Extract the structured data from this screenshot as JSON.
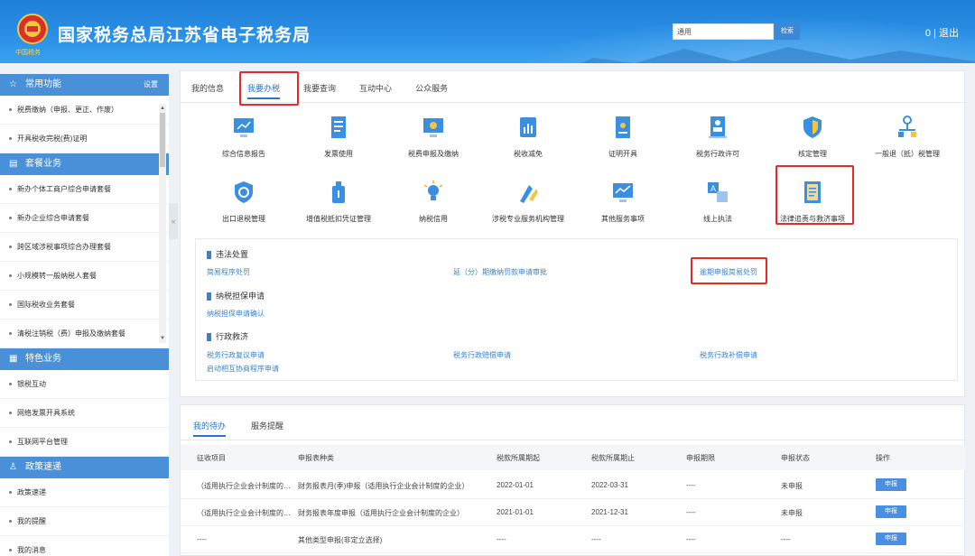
{
  "header": {
    "title": "国家税务总局江苏省电子税务局",
    "logo_sub": "中国税务",
    "search_value": "通用",
    "search_btn": "检索",
    "links": "0 | 退出"
  },
  "sidebar": {
    "section1": {
      "title": "常用功能",
      "extra": "设置"
    },
    "section1_items": [
      "税费缴纳（申报、更正、作废）",
      "开具税收完税(费)证明"
    ],
    "section2": {
      "title": "套餐业务"
    },
    "section2_items": [
      "新办个体工商户综合申请套餐",
      "新办企业综合申请套餐",
      "跨区域涉税事项综合办理套餐",
      "小规模转一般纳税人套餐",
      "国际税收业务套餐",
      "清税注销税（费）申报及缴纳套餐"
    ],
    "section3": {
      "title": "特色业务"
    },
    "section3_items": [
      "银税互动",
      "网络发票开具系统",
      "互联网平台管理"
    ],
    "section4": {
      "title": "政策速递"
    },
    "section4_items": [
      "政策速递",
      "我的提醒",
      "我的消息"
    ]
  },
  "tabs": [
    "我的信息",
    "我要办税",
    "我要查询",
    "互动中心",
    "公众服务"
  ],
  "icons_row1": [
    "综合信息报告",
    "发票使用",
    "税费申报及缴纳",
    "税收减免",
    "证明开具",
    "税务行政许可",
    "核定管理",
    "一般退（抵）税管理"
  ],
  "icons_row2": [
    "出口退税管理",
    "增值税抵扣凭证管理",
    "纳税信用",
    "涉税专业服务机构管理",
    "其他服务事项",
    "线上执法",
    "法律追责与救济事项"
  ],
  "sub": {
    "group1": "违法处置",
    "group1_links": [
      "简易程序处罚",
      "延（分）期缴纳罚款申请审批",
      "逾期申报简易处罚"
    ],
    "group2": "纳税担保申请",
    "group2_links": [
      "纳税担保申请确认"
    ],
    "group3": "行政救济",
    "group3_links": [
      "税务行政复议申请",
      "税务行政赔偿申请",
      "税务行政补偿申请",
      "启动相互协商程序申请"
    ]
  },
  "bottom_tabs": [
    "我的待办",
    "服务提醒"
  ],
  "table": {
    "headers": [
      "征收项目",
      "申报表种类",
      "税款所属期起",
      "税款所属期止",
      "申报期限",
      "申报状态",
      "操作"
    ],
    "rows": [
      [
        "（适用执行企业会计制度的…",
        "财务报表月(季)申报（适用执行企业会计制度的企业）",
        "2022-01-01",
        "2022-03-31",
        "----",
        "未申报",
        "申报"
      ],
      [
        "（适用执行企业会计制度的…",
        "财务报表年度申报（适用执行企业会计制度的企业）",
        "2021-01-01",
        "2021-12-31",
        "----",
        "未申报",
        "申报"
      ],
      [
        "----",
        "其他类型申报(非定立选择)",
        "----",
        "----",
        "----",
        "----",
        "申报"
      ]
    ]
  },
  "colors": {
    "accent": "#2b74c9",
    "header": "#2a8fe6",
    "highlight": "#e62a2a"
  }
}
